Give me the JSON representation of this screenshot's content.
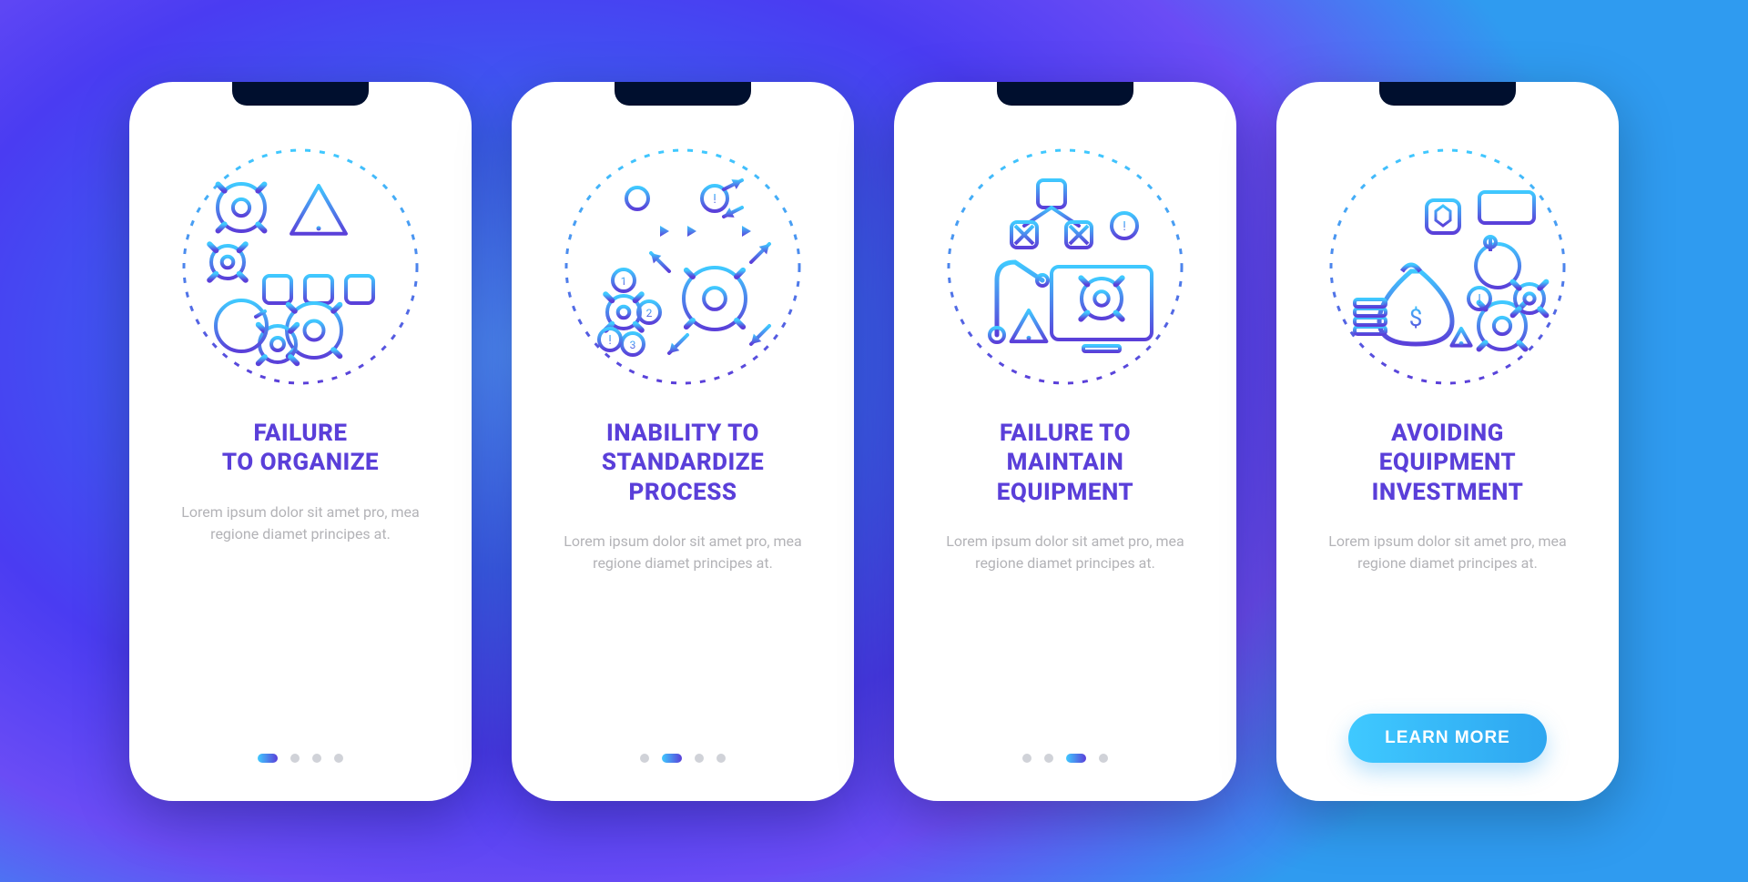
{
  "screens": [
    {
      "id": "failure-to-organize",
      "title": "FAILURE\nTO ORGANIZE",
      "description": "Lorem ipsum dolor sit amet pro, mea regione diamet principes at.",
      "active_index": 0,
      "show_dots": true,
      "show_cta": false,
      "icon": "organize"
    },
    {
      "id": "inability-to-standardize",
      "title": "INABILITY TO\nSTANDARDIZE\nPROCESS",
      "description": "Lorem ipsum dolor sit amet pro, mea regione diamet principes at.",
      "active_index": 1,
      "show_dots": true,
      "show_cta": false,
      "icon": "standardize"
    },
    {
      "id": "failure-to-maintain",
      "title": "FAILURE TO\nMAINTAIN\nEQUIPMENT",
      "description": "Lorem ipsum dolor sit amet pro, mea regione diamet principes at.",
      "active_index": 2,
      "show_dots": true,
      "show_cta": false,
      "icon": "maintain"
    },
    {
      "id": "avoiding-investment",
      "title": "AVOIDING\nEQUIPMENT\nINVESTMENT",
      "description": "Lorem ipsum dolor sit amet pro, mea regione diamet principes at.",
      "active_index": 3,
      "show_dots": false,
      "show_cta": true,
      "icon": "investment"
    }
  ],
  "dots_count": 4,
  "cta_label": "LEARN MORE",
  "colors": {
    "grad_start": "#3fc9ff",
    "grad_end": "#5a3fd9",
    "title": "#5a3fd9",
    "desc": "#b3b3b7"
  }
}
